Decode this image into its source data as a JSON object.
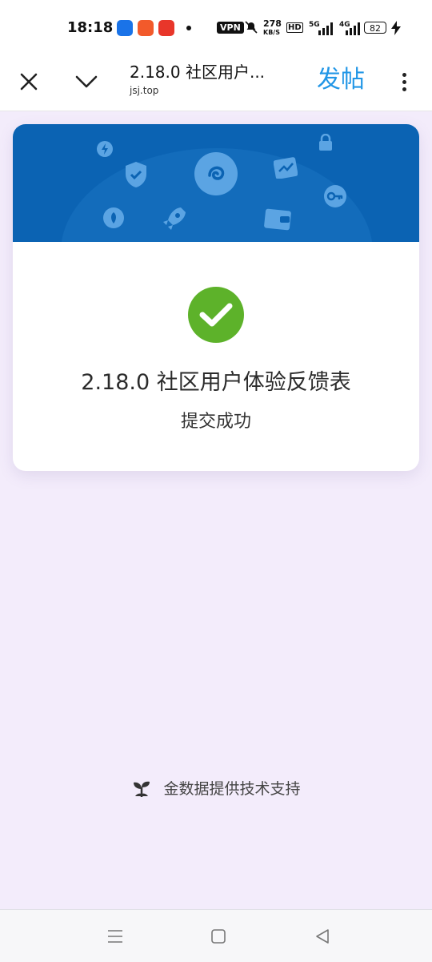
{
  "status_bar": {
    "time": "18:18",
    "app_icons": [
      "app-icon-blue",
      "app-icon-orange",
      "app-icon-toutiao"
    ],
    "vpn": "VPN",
    "speed": "278",
    "speed_unit": "KB/S",
    "hd": "HD",
    "net1": "5G",
    "net2": "4G",
    "battery": "82"
  },
  "header": {
    "title": "2.18.0 社区用户...",
    "subtitle": "jsj.top",
    "post_label": "发帖",
    "close_icon": "close-icon",
    "collapse_icon": "chevron-down-icon",
    "more_icon": "more-vertical-icon"
  },
  "card": {
    "banner_color": "#0b63b3",
    "success_icon": "check-icon",
    "success_color": "#5db22a",
    "title": "2.18.0 社区用户体验反馈表",
    "subtitle": "提交成功"
  },
  "footer": {
    "powered_by": "金数据提供技术支持",
    "logo_icon": "sprout-icon"
  },
  "nav": {
    "menu_icon": "menu-icon",
    "home_icon": "square-icon",
    "back_icon": "back-triangle-icon"
  }
}
